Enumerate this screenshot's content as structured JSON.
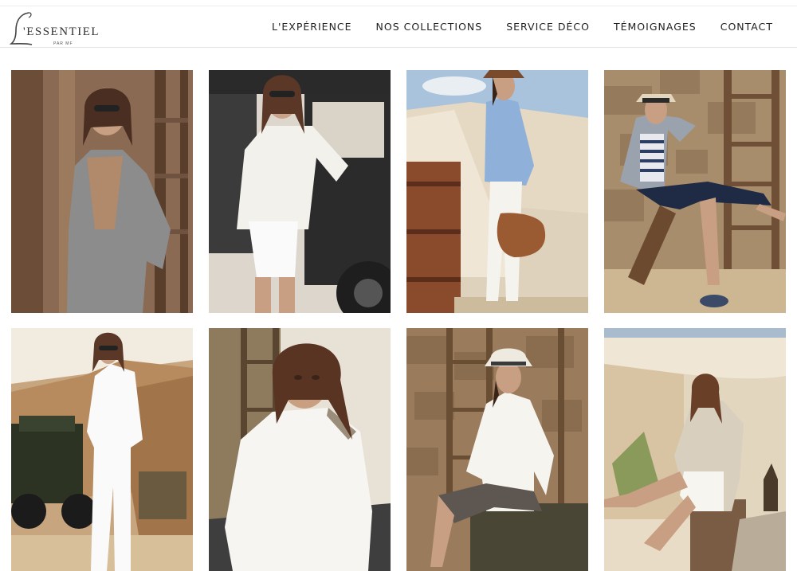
{
  "brand": {
    "initial": "L",
    "wordmark": "'ESSENTIEL",
    "tagline": "PAR MF"
  },
  "nav": {
    "items": [
      {
        "label": "L'EXPÉRIENCE"
      },
      {
        "label": "NOS COLLECTIONS"
      },
      {
        "label": "SERVICE DÉCO"
      },
      {
        "label": "TÉMOIGNAGES"
      },
      {
        "label": "CONTACT"
      }
    ]
  },
  "gallery": {
    "photos": [
      {
        "subject": "model-sunglasses-grey-cardigan-wooden-wall"
      },
      {
        "subject": "model-white-jacket-jeep"
      },
      {
        "subject": "model-blue-jacket-brown-bag-desert"
      },
      {
        "subject": "model-hat-striped-top-sitting-stone-wall"
      },
      {
        "subject": "model-white-outfit-jeep-quarry"
      },
      {
        "subject": "model-white-sweater-closeup"
      },
      {
        "subject": "model-white-hat-sitting-crate"
      },
      {
        "subject": "model-sitting-desert-canopy"
      }
    ]
  },
  "colors": {
    "text": "#222222",
    "border": "#e4e4e4",
    "sand": "#d9c4a4",
    "wood": "#7a5b43",
    "sky": "#a9c3dc",
    "stone": "#a88d6c"
  }
}
